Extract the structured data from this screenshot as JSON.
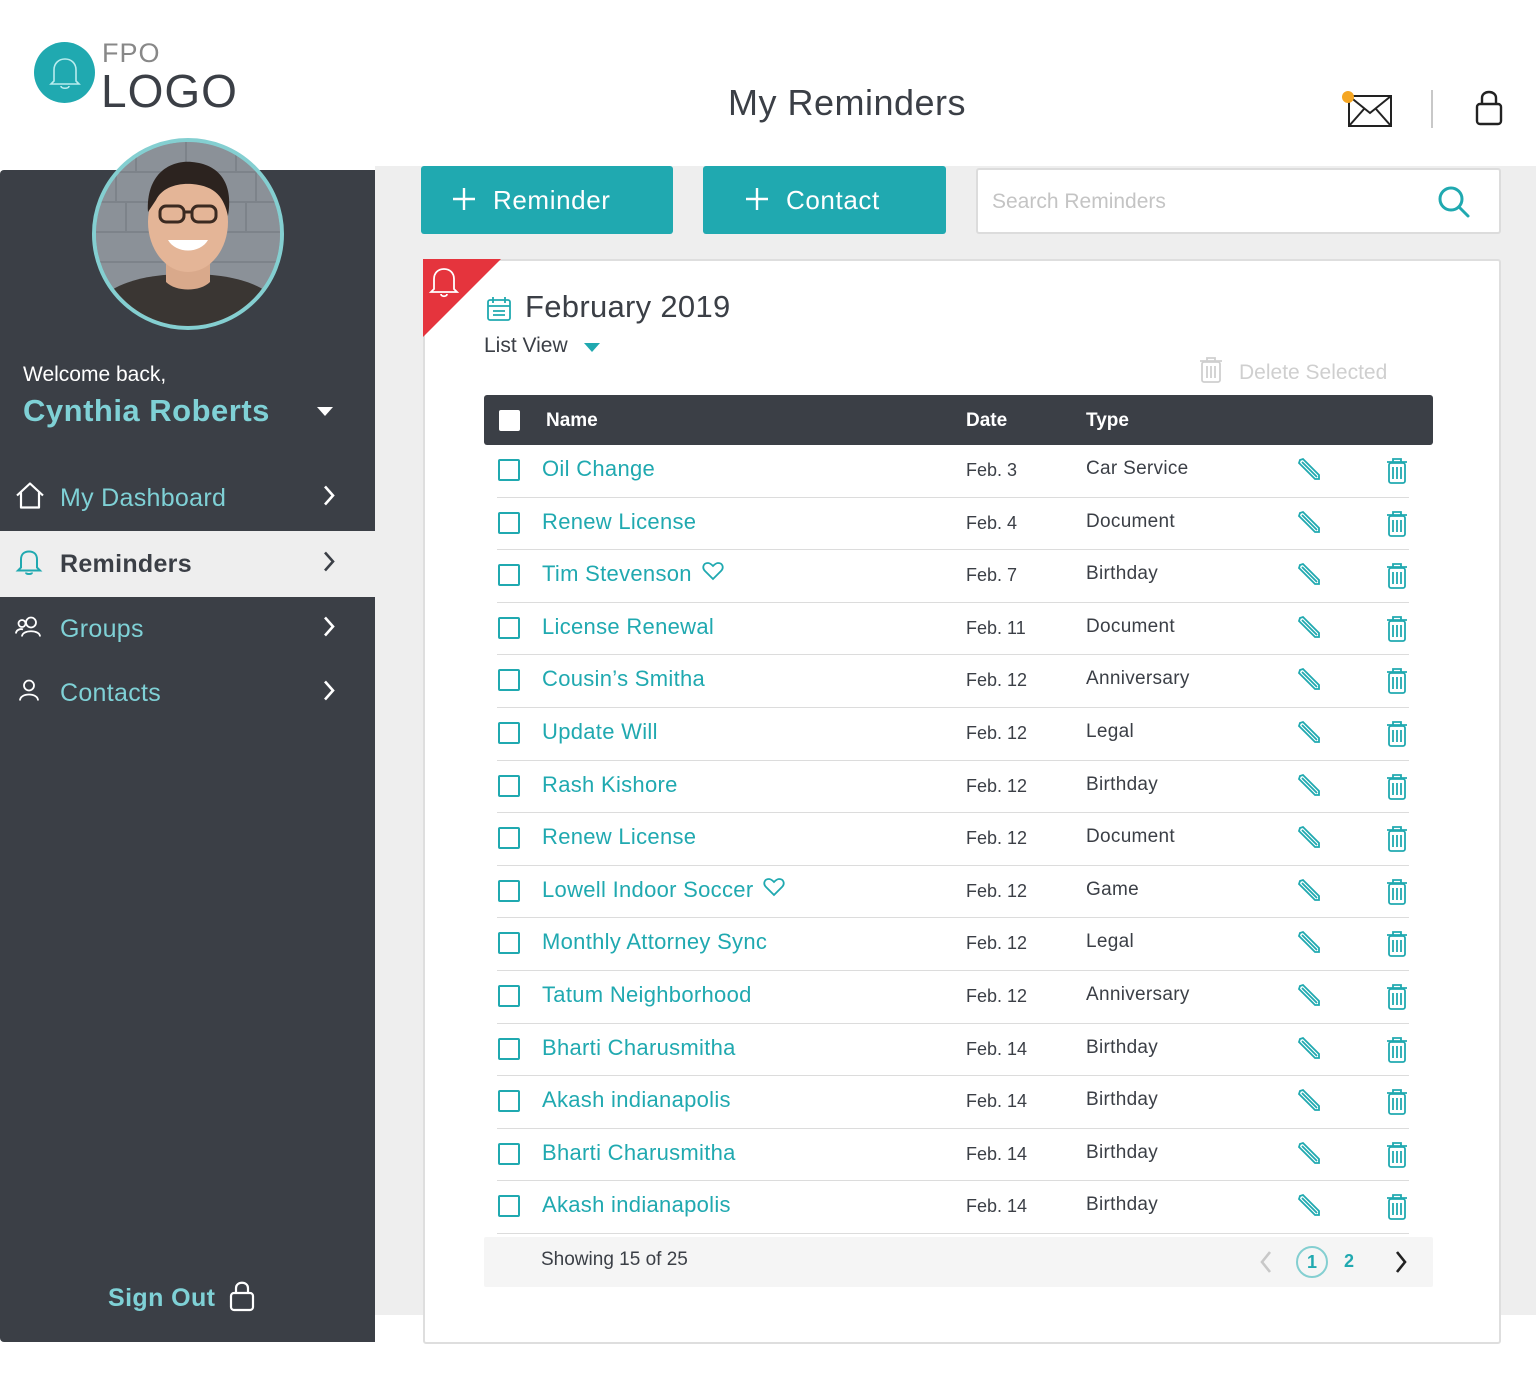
{
  "logo": {
    "small": "FPO",
    "word": "LOGO"
  },
  "header": {
    "title": "My Reminders",
    "mail_icon": "mail-icon",
    "lock_icon": "lock-icon",
    "notification_color": "#f5a623"
  },
  "sidebar": {
    "welcome": "Welcome back,",
    "user_name": "Cynthia Roberts",
    "items": [
      {
        "label": "My Dashboard",
        "icon": "home-icon"
      },
      {
        "label": "Reminders",
        "icon": "bell-icon",
        "active": true
      },
      {
        "label": "Groups",
        "icon": "group-icon"
      },
      {
        "label": "Contacts",
        "icon": "user-icon"
      }
    ],
    "sign_out": "Sign Out"
  },
  "toolbar": {
    "reminder_label": "Reminder",
    "contact_label": "Contact",
    "search_placeholder": "Search Reminders"
  },
  "card": {
    "month": "February 2019",
    "view": "List View",
    "delete_selected": "Delete Selected"
  },
  "table": {
    "columns": {
      "name": "Name",
      "date": "Date",
      "type": "Type"
    },
    "rows": [
      {
        "name": "Oil Change",
        "date": "Feb. 3",
        "type": "Car Service",
        "favorite": false
      },
      {
        "name": "Renew License",
        "date": "Feb. 4",
        "type": "Document",
        "favorite": false
      },
      {
        "name": "Tim Stevenson",
        "date": "Feb. 7",
        "type": "Birthday",
        "favorite": true
      },
      {
        "name": "License Renewal",
        "date": "Feb. 11",
        "type": "Document",
        "favorite": false
      },
      {
        "name": "Cousin’s Smitha",
        "date": "Feb. 12",
        "type": "Anniversary",
        "favorite": false
      },
      {
        "name": "Update Will",
        "date": "Feb. 12",
        "type": "Legal",
        "favorite": false
      },
      {
        "name": "Rash Kishore",
        "date": "Feb. 12",
        "type": "Birthday",
        "favorite": false
      },
      {
        "name": "Renew License",
        "date": "Feb. 12",
        "type": "Document",
        "favorite": false
      },
      {
        "name": "Lowell Indoor Soccer",
        "date": "Feb. 12",
        "type": "Game",
        "favorite": true
      },
      {
        "name": "Monthly Attorney Sync",
        "date": "Feb. 12",
        "type": "Legal",
        "favorite": false
      },
      {
        "name": "Tatum Neighborhood",
        "date": "Feb. 12",
        "type": "Anniversary",
        "favorite": false
      },
      {
        "name": "Bharti Charusmitha",
        "date": "Feb. 14",
        "type": "Birthday",
        "favorite": false
      },
      {
        "name": "Akash indianapolis",
        "date": "Feb. 14",
        "type": "Birthday",
        "favorite": false
      },
      {
        "name": "Bharti Charusmitha",
        "date": "Feb. 14",
        "type": "Birthday",
        "favorite": false
      },
      {
        "name": "Akash indianapolis",
        "date": "Feb. 14",
        "type": "Birthday",
        "favorite": false
      }
    ]
  },
  "pagination": {
    "showing": "Showing 15 of 25",
    "pages": [
      "1",
      "2"
    ],
    "current": "1"
  },
  "colors": {
    "accent": "#20a9b0",
    "accent_light": "#7fd1d6",
    "sidebar": "#3b3f46",
    "flag": "#e5343d"
  }
}
